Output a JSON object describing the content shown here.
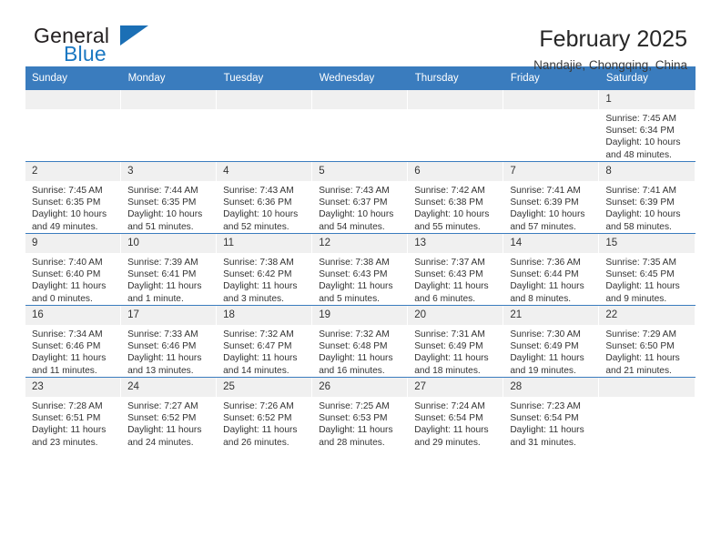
{
  "brand": {
    "name_top": "General",
    "name_bottom": "Blue",
    "triangle_color": "#1b6fb5"
  },
  "header": {
    "title": "February 2025",
    "subtitle": "Nandajie, Chongqing, China"
  },
  "theme": {
    "header_blue": "#3a7cbe",
    "daynum_band": "#f0f0f0",
    "text": "#333333"
  },
  "weekdays": [
    "Sunday",
    "Monday",
    "Tuesday",
    "Wednesday",
    "Thursday",
    "Friday",
    "Saturday"
  ],
  "labels": {
    "sunrise_prefix": "Sunrise:",
    "sunset_prefix": "Sunset:",
    "daylight_prefix": "Daylight:"
  },
  "weeks": [
    [
      {
        "day": "",
        "empty": true
      },
      {
        "day": "",
        "empty": true
      },
      {
        "day": "",
        "empty": true
      },
      {
        "day": "",
        "empty": true
      },
      {
        "day": "",
        "empty": true
      },
      {
        "day": "",
        "empty": true
      },
      {
        "day": "1",
        "sunrise": "Sunrise: 7:45 AM",
        "sunset": "Sunset: 6:34 PM",
        "daylight": "Daylight: 10 hours and 48 minutes."
      }
    ],
    [
      {
        "day": "2",
        "sunrise": "Sunrise: 7:45 AM",
        "sunset": "Sunset: 6:35 PM",
        "daylight": "Daylight: 10 hours and 49 minutes."
      },
      {
        "day": "3",
        "sunrise": "Sunrise: 7:44 AM",
        "sunset": "Sunset: 6:35 PM",
        "daylight": "Daylight: 10 hours and 51 minutes."
      },
      {
        "day": "4",
        "sunrise": "Sunrise: 7:43 AM",
        "sunset": "Sunset: 6:36 PM",
        "daylight": "Daylight: 10 hours and 52 minutes."
      },
      {
        "day": "5",
        "sunrise": "Sunrise: 7:43 AM",
        "sunset": "Sunset: 6:37 PM",
        "daylight": "Daylight: 10 hours and 54 minutes."
      },
      {
        "day": "6",
        "sunrise": "Sunrise: 7:42 AM",
        "sunset": "Sunset: 6:38 PM",
        "daylight": "Daylight: 10 hours and 55 minutes."
      },
      {
        "day": "7",
        "sunrise": "Sunrise: 7:41 AM",
        "sunset": "Sunset: 6:39 PM",
        "daylight": "Daylight: 10 hours and 57 minutes."
      },
      {
        "day": "8",
        "sunrise": "Sunrise: 7:41 AM",
        "sunset": "Sunset: 6:39 PM",
        "daylight": "Daylight: 10 hours and 58 minutes."
      }
    ],
    [
      {
        "day": "9",
        "sunrise": "Sunrise: 7:40 AM",
        "sunset": "Sunset: 6:40 PM",
        "daylight": "Daylight: 11 hours and 0 minutes."
      },
      {
        "day": "10",
        "sunrise": "Sunrise: 7:39 AM",
        "sunset": "Sunset: 6:41 PM",
        "daylight": "Daylight: 11 hours and 1 minute."
      },
      {
        "day": "11",
        "sunrise": "Sunrise: 7:38 AM",
        "sunset": "Sunset: 6:42 PM",
        "daylight": "Daylight: 11 hours and 3 minutes."
      },
      {
        "day": "12",
        "sunrise": "Sunrise: 7:38 AM",
        "sunset": "Sunset: 6:43 PM",
        "daylight": "Daylight: 11 hours and 5 minutes."
      },
      {
        "day": "13",
        "sunrise": "Sunrise: 7:37 AM",
        "sunset": "Sunset: 6:43 PM",
        "daylight": "Daylight: 11 hours and 6 minutes."
      },
      {
        "day": "14",
        "sunrise": "Sunrise: 7:36 AM",
        "sunset": "Sunset: 6:44 PM",
        "daylight": "Daylight: 11 hours and 8 minutes."
      },
      {
        "day": "15",
        "sunrise": "Sunrise: 7:35 AM",
        "sunset": "Sunset: 6:45 PM",
        "daylight": "Daylight: 11 hours and 9 minutes."
      }
    ],
    [
      {
        "day": "16",
        "sunrise": "Sunrise: 7:34 AM",
        "sunset": "Sunset: 6:46 PM",
        "daylight": "Daylight: 11 hours and 11 minutes."
      },
      {
        "day": "17",
        "sunrise": "Sunrise: 7:33 AM",
        "sunset": "Sunset: 6:46 PM",
        "daylight": "Daylight: 11 hours and 13 minutes."
      },
      {
        "day": "18",
        "sunrise": "Sunrise: 7:32 AM",
        "sunset": "Sunset: 6:47 PM",
        "daylight": "Daylight: 11 hours and 14 minutes."
      },
      {
        "day": "19",
        "sunrise": "Sunrise: 7:32 AM",
        "sunset": "Sunset: 6:48 PM",
        "daylight": "Daylight: 11 hours and 16 minutes."
      },
      {
        "day": "20",
        "sunrise": "Sunrise: 7:31 AM",
        "sunset": "Sunset: 6:49 PM",
        "daylight": "Daylight: 11 hours and 18 minutes."
      },
      {
        "day": "21",
        "sunrise": "Sunrise: 7:30 AM",
        "sunset": "Sunset: 6:49 PM",
        "daylight": "Daylight: 11 hours and 19 minutes."
      },
      {
        "day": "22",
        "sunrise": "Sunrise: 7:29 AM",
        "sunset": "Sunset: 6:50 PM",
        "daylight": "Daylight: 11 hours and 21 minutes."
      }
    ],
    [
      {
        "day": "23",
        "sunrise": "Sunrise: 7:28 AM",
        "sunset": "Sunset: 6:51 PM",
        "daylight": "Daylight: 11 hours and 23 minutes."
      },
      {
        "day": "24",
        "sunrise": "Sunrise: 7:27 AM",
        "sunset": "Sunset: 6:52 PM",
        "daylight": "Daylight: 11 hours and 24 minutes."
      },
      {
        "day": "25",
        "sunrise": "Sunrise: 7:26 AM",
        "sunset": "Sunset: 6:52 PM",
        "daylight": "Daylight: 11 hours and 26 minutes."
      },
      {
        "day": "26",
        "sunrise": "Sunrise: 7:25 AM",
        "sunset": "Sunset: 6:53 PM",
        "daylight": "Daylight: 11 hours and 28 minutes."
      },
      {
        "day": "27",
        "sunrise": "Sunrise: 7:24 AM",
        "sunset": "Sunset: 6:54 PM",
        "daylight": "Daylight: 11 hours and 29 minutes."
      },
      {
        "day": "28",
        "sunrise": "Sunrise: 7:23 AM",
        "sunset": "Sunset: 6:54 PM",
        "daylight": "Daylight: 11 hours and 31 minutes."
      },
      {
        "day": "",
        "empty": true
      }
    ]
  ]
}
